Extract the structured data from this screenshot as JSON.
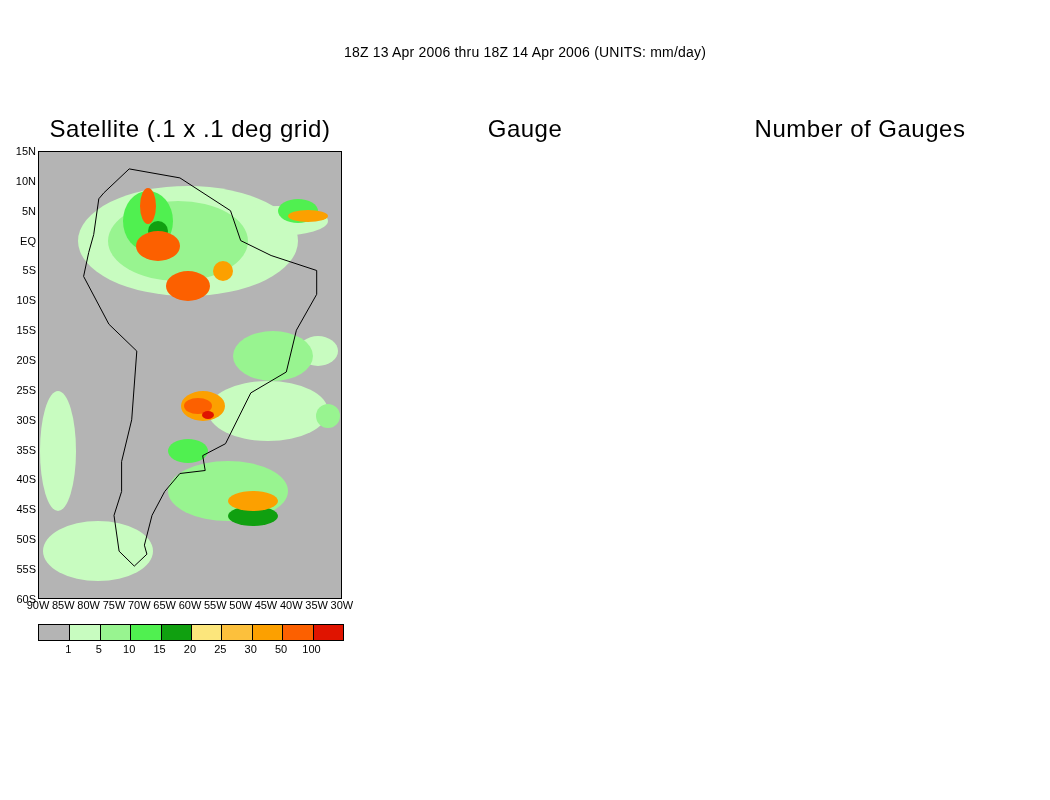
{
  "header": {
    "title": "18Z 13 Apr 2006 thru 18Z 14 Apr 2006 (UNITS: mm/day)"
  },
  "panels": [
    {
      "title": "Satellite (.1 x .1 deg grid)",
      "map": {
        "lat_labels": [
          "15N",
          "10N",
          "5N",
          "EQ",
          "5S",
          "10S",
          "15S",
          "20S",
          "25S",
          "30S",
          "35S",
          "40S",
          "45S",
          "50S",
          "55S",
          "60S"
        ],
        "lon_labels": [
          "90W",
          "85W",
          "80W",
          "75W",
          "70W",
          "65W",
          "60W",
          "55W",
          "50W",
          "45W",
          "40W",
          "35W",
          "30W"
        ]
      }
    },
    {
      "title": "Gauge"
    },
    {
      "title": "Number of Gauges"
    }
  ],
  "legend": {
    "bins": [
      {
        "color": "#b4b4b4"
      },
      {
        "color": "#c8fcc0"
      },
      {
        "color": "#98f490"
      },
      {
        "color": "#50f050"
      },
      {
        "color": "#10a010"
      },
      {
        "color": "#fce67c"
      },
      {
        "color": "#fcc03c"
      },
      {
        "color": "#fca000"
      },
      {
        "color": "#fc6000"
      },
      {
        "color": "#e01400"
      }
    ],
    "labels": [
      "1",
      "5",
      "10",
      "15",
      "20",
      "25",
      "30",
      "50",
      "100"
    ]
  }
}
